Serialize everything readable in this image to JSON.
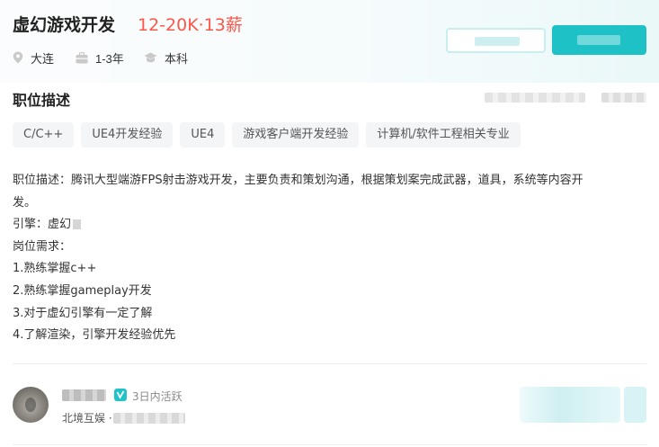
{
  "header": {
    "job_title": "虚幻游戏开发",
    "salary": "12-20K·13薪"
  },
  "meta": {
    "city": "大连",
    "experience": "1-3年",
    "education": "本科"
  },
  "section": {
    "title": "职位描述"
  },
  "tags": [
    "C/C++",
    "UE4开发经验",
    "UE4",
    "游戏客户端开发经验",
    "计算机/软件工程相关专业"
  ],
  "description": [
    "职位描述：腾讯大型端游FPS射击游戏开发，主要负责和策划沟通，根据策划案完成武器，道具，系统等内容开",
    "发。",
    "引擎：虚幻",
    "岗位需求：",
    "1.熟练掌握c++",
    "2.熟练掌握gameplay开发",
    "3.对于虚幻引擎有一定了解",
    "4.了解渲染，引擎开发经验优先"
  ],
  "recruiter": {
    "active_status": "3日内活跃",
    "company": "北境互娱 ·"
  },
  "colors": {
    "salary": "#fe574a",
    "accent": "#1ec1c6"
  }
}
